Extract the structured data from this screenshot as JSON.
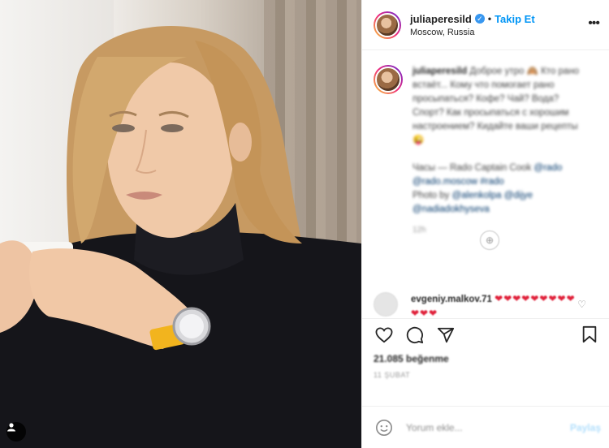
{
  "header": {
    "username": "juliaperesild",
    "separator": "•",
    "follow_label": "Takip Et",
    "location": "Moscow, Russia",
    "more_icon": "more-horizontal-icon"
  },
  "caption": {
    "username": "juliaperesild",
    "text_1": "Доброе утро 🙈 Кто рано встаёт... Кому что помогает рано просыпаться? Кофе? Чай? Вода? Спорт? Как просыпаться с хорошим настроением? Кидайте ваши рецепты 😜",
    "text_2": "Часы — Rado Captain Cook",
    "link_1": "@rado @rado.moscow #rado",
    "text_3": "Photo by",
    "link_2": "@alenkolpa @dijye @nadiadokhyseva",
    "time": "12h"
  },
  "comment": {
    "username": "evgeniy.malkov.71",
    "hearts": "❤❤❤❤❤❤❤❤❤❤❤❤",
    "faces": "😂😂😂😂😂😂😂😂😂😂😂😂"
  },
  "actions": {
    "likes": "21.085 beğenme",
    "date": "11 ŞUBAT"
  },
  "add_comment": {
    "placeholder": "Yorum ekle...",
    "post_label": "Paylaş"
  },
  "colors": {
    "accent": "#0095f6",
    "verified": "#3897f0",
    "watch_strap": "#f2b41e"
  }
}
